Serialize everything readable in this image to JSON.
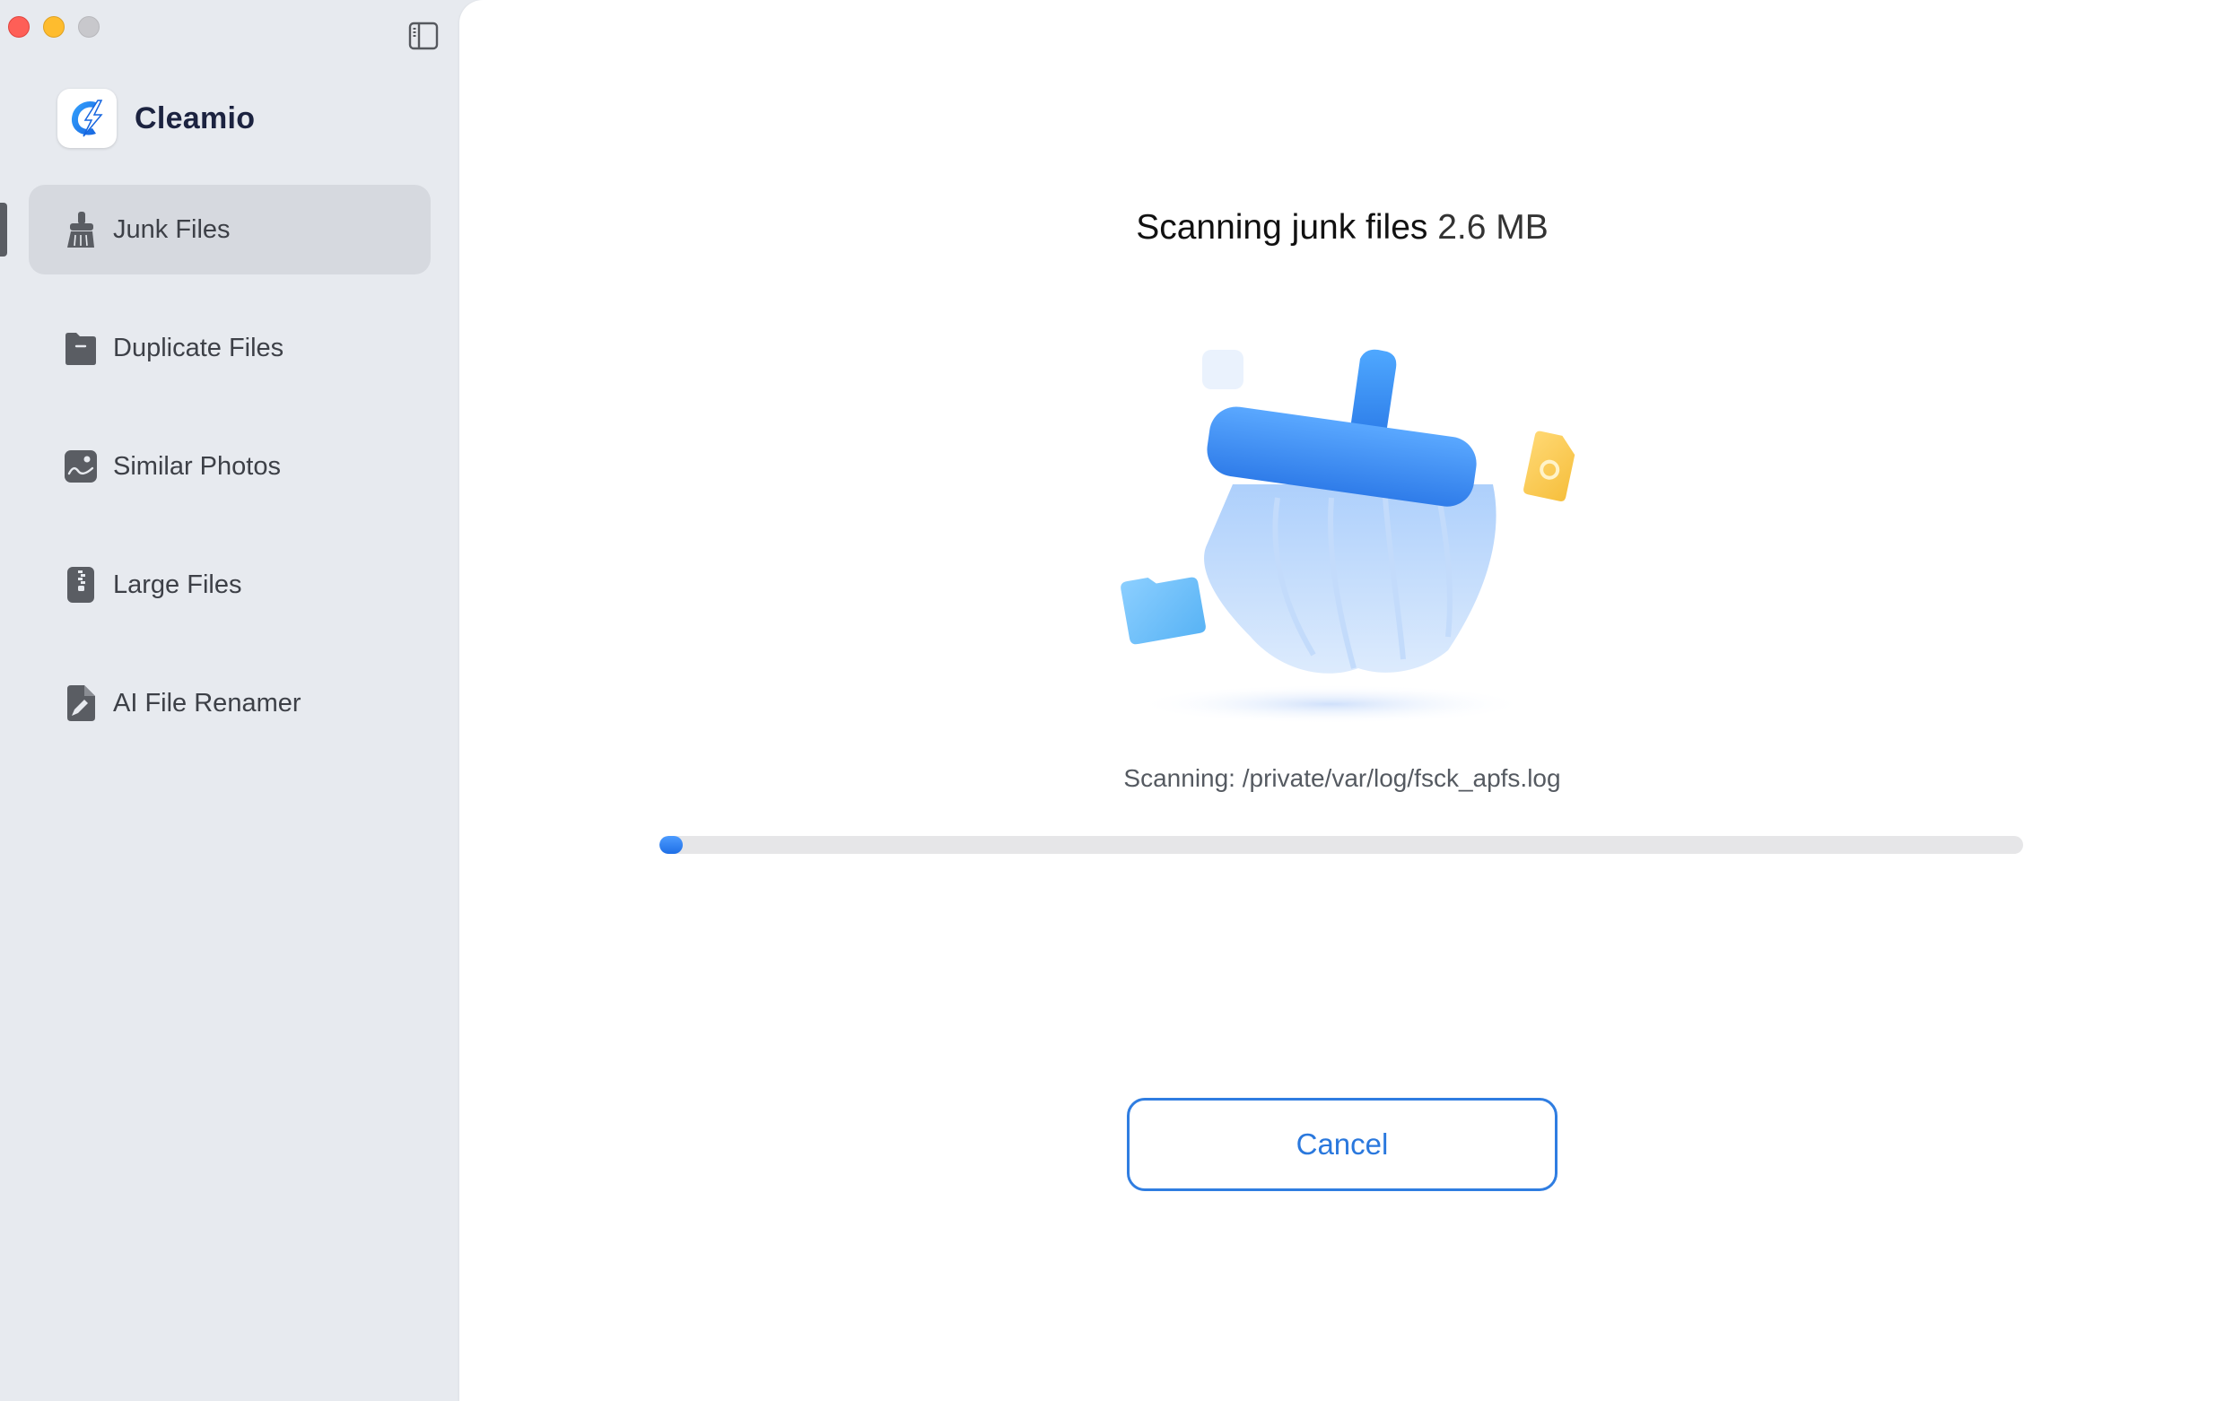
{
  "window": {
    "traffic_lights": [
      "close",
      "minimize",
      "maximize"
    ]
  },
  "sidebar": {
    "toggle_icon": "sidebar-toggle-icon",
    "brand": {
      "name": "Cleamio",
      "logo_icon": "cleamio-logo-icon"
    },
    "items": [
      {
        "label": "Junk Files",
        "icon": "broom-icon",
        "active": true
      },
      {
        "label": "Duplicate Files",
        "icon": "folder-icon",
        "active": false
      },
      {
        "label": "Similar Photos",
        "icon": "photo-icon",
        "active": false
      },
      {
        "label": "Large Files",
        "icon": "zip-file-icon",
        "active": false
      },
      {
        "label": "AI File Renamer",
        "icon": "file-edit-icon",
        "active": false
      }
    ]
  },
  "main": {
    "title_prefix": "Scanning junk files",
    "title_size": "2.6 MB",
    "scanning_path": "Scanning: /private/var/log/fsck_apfs.log",
    "progress_percent": 1,
    "cancel_label": "Cancel",
    "illustration_icon": "broom-sweeping-illustration"
  },
  "colors": {
    "accent": "#2f7de1",
    "sidebar_bg": "#e7eaef",
    "active_item_bg": "#d6d9df",
    "close": "#fe5f57",
    "minimize": "#febc2e",
    "maximize": "#c8c8cc"
  }
}
